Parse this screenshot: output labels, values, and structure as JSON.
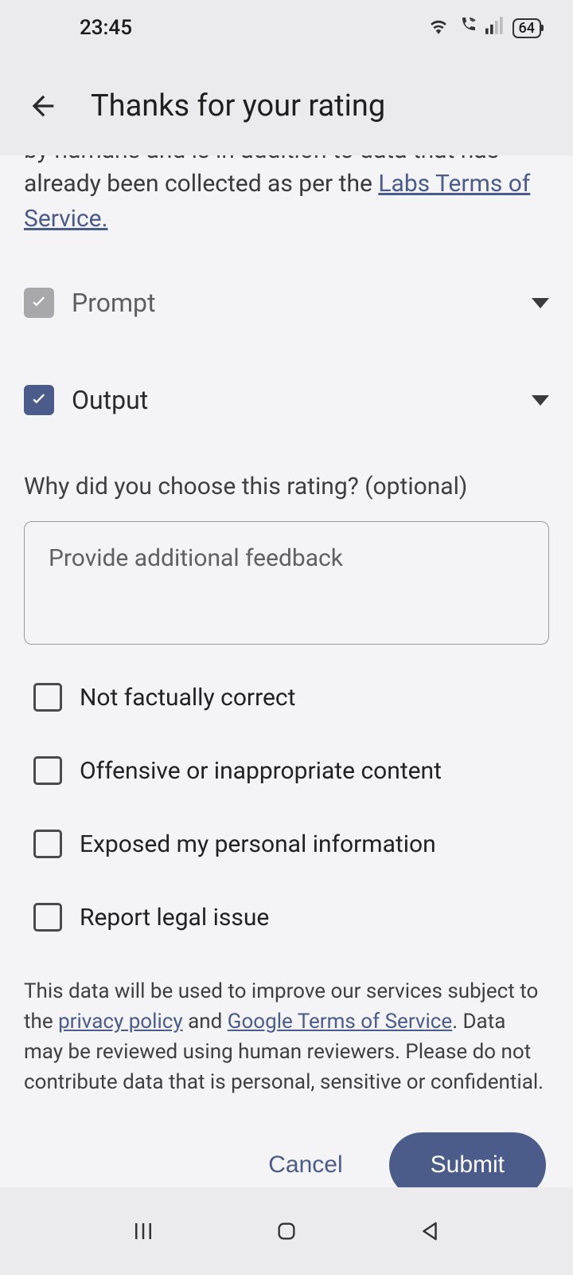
{
  "status": {
    "time": "23:45",
    "battery": "64"
  },
  "header": {
    "title": "Thanks for your rating"
  },
  "partial_text": {
    "line1": "by humans and is in addition to data that has",
    "line2_a": "already been collected as per the ",
    "link": "Labs Terms of Service."
  },
  "sections": {
    "prompt_label": "Prompt",
    "output_label": "Output"
  },
  "question": "Why did you choose this rating? (optional)",
  "textarea_placeholder": "Provide additional feedback",
  "options": [
    "Not factually correct",
    "Offensive or inappropriate content",
    "Exposed my personal information",
    "Report legal issue"
  ],
  "disclaimer": {
    "part1": "This data will be used to improve our services subject to the ",
    "link1": "privacy policy",
    "part2": " and ",
    "link2": "Google Terms of Service",
    "part3": ". Data may be reviewed using human reviewers. Please do not contribute data that is personal, sensitive or confidential."
  },
  "buttons": {
    "cancel": "Cancel",
    "submit": "Submit"
  }
}
